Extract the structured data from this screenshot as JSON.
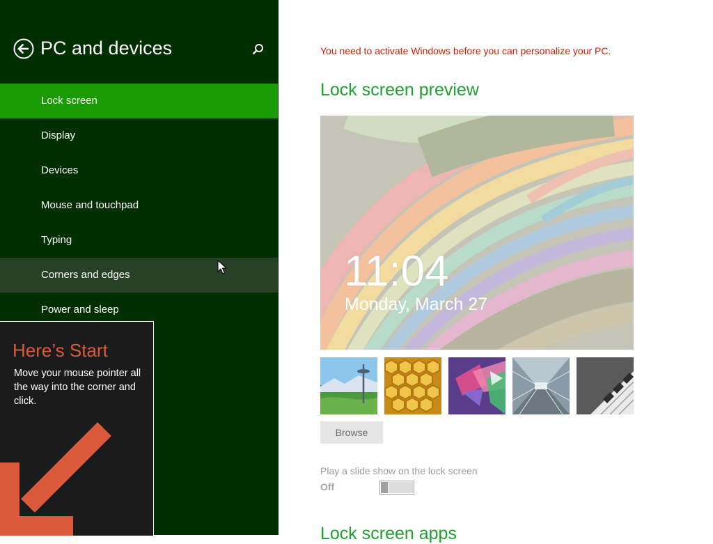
{
  "sidebar": {
    "title": "PC and devices",
    "back_icon": "back-arrow-circle-icon",
    "search_icon": "search-icon",
    "items": [
      {
        "label": "Lock screen",
        "state": "selected"
      },
      {
        "label": "Display",
        "state": "normal"
      },
      {
        "label": "Devices",
        "state": "normal"
      },
      {
        "label": "Mouse and touchpad",
        "state": "normal"
      },
      {
        "label": "Typing",
        "state": "normal"
      },
      {
        "label": "Corners and edges",
        "state": "hover"
      },
      {
        "label": "Power and sleep",
        "state": "normal"
      }
    ]
  },
  "start_tip": {
    "title": "Here’s Start",
    "body": "Move your mouse pointer all the way into the corner and click."
  },
  "main": {
    "activation_warning": "You need to activate Windows before you can personalize your PC.",
    "preview_heading": "Lock screen preview",
    "preview_time": "11:04",
    "preview_date": "Monday, March 27",
    "thumbnails": [
      "space-needle-landscape",
      "honeycomb",
      "colorful-geometric-shapes",
      "train-tunnel",
      "piano-keys"
    ],
    "browse_label": "Browse",
    "slideshow_label": "Play a slide show on the lock screen",
    "slideshow_state": "Off",
    "apps_heading": "Lock screen apps"
  },
  "colors": {
    "sidebar_bg": "#012f01",
    "selected_item": "#1a9a05",
    "hover_item": "#264126",
    "heading_green": "#21a031",
    "warning_red": "#cf1e00",
    "tip_accent": "#dc5a3c"
  }
}
